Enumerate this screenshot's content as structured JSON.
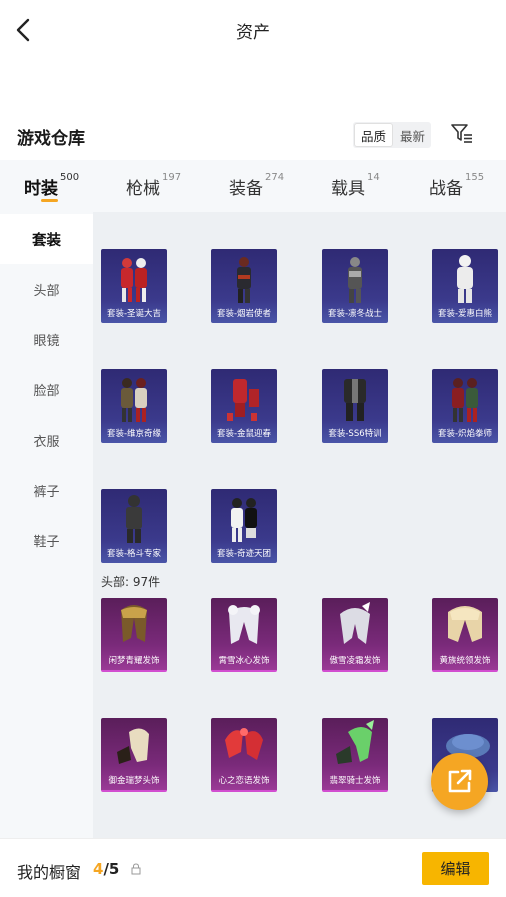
{
  "header": {
    "title": "资产",
    "back_icon": "chevron-left-icon"
  },
  "warehouse": {
    "title": "游戏仓库",
    "sort_options": [
      "品质",
      "最新"
    ],
    "active_sort": "品质",
    "filter_icon": "filter-icon"
  },
  "tabs": [
    {
      "label": "时装",
      "count": "500",
      "active": true
    },
    {
      "label": "枪械",
      "count": "197",
      "active": false
    },
    {
      "label": "装备",
      "count": "274",
      "active": false
    },
    {
      "label": "载具",
      "count": "14",
      "active": false
    },
    {
      "label": "战备",
      "count": "155",
      "active": false
    }
  ],
  "sidebar": {
    "items": [
      "套装",
      "头部",
      "眼镜",
      "脸部",
      "衣服",
      "裤子",
      "鞋子"
    ],
    "active": "套装"
  },
  "sections": {
    "suits": {
      "items": [
        "套装-圣诞大吉",
        "套装-烟岩使者",
        "套装-凛冬战士",
        "套装-爱惠白熊",
        "套装-维京奇缘",
        "套装-金鼠迎春",
        "套装-SS6特训",
        "套装-炽焰拳师",
        "套装-格斗专家",
        "套装-奇迹天团"
      ]
    },
    "head": {
      "label": "头部: 97件",
      "items": [
        "闲梦青耀发饰",
        "霄雪冰心发饰",
        "傲雪凌霜发饰",
        "黄族统领发饰",
        "御金瑞梦头饰",
        "心之恋语发饰",
        "翡翠骑士发饰",
        ""
      ]
    }
  },
  "colors": {
    "accent": "#f5a623",
    "suit_card": "#3b3a8c",
    "rare_card": "#7a2a7a"
  },
  "fab_icon": "share-external-icon",
  "bottom": {
    "label": "我的橱窗",
    "current": "4",
    "sep": "/",
    "total": "5",
    "lock_icon": "lock-icon",
    "edit_label": "编辑"
  }
}
